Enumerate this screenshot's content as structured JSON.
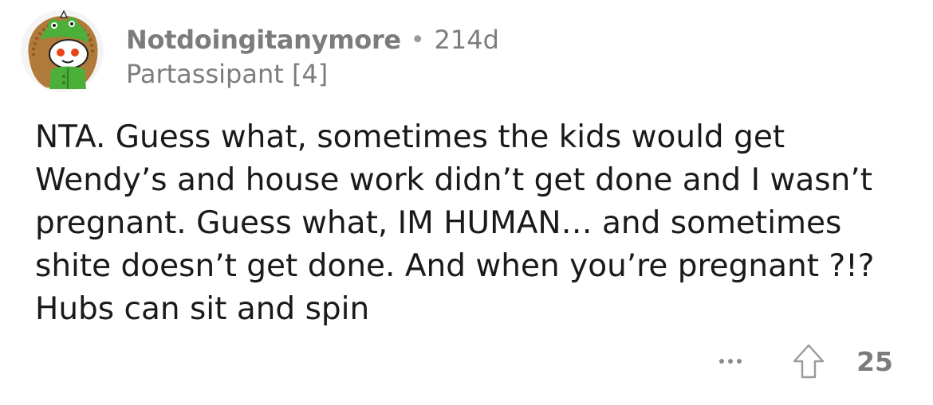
{
  "comment": {
    "author": "Notdoingitanymore",
    "separator": "•",
    "age": "214d",
    "flair": "Partassipant [4]",
    "body": "NTA. Guess what, sometimes the kids would get Wendy’s and house work didn’t get done and I wasn’t pregnant. Guess what, IM HUMAN… and sometimes shite doesn’t get done. And when you’re pregnant ?!? Hubs can sit and spin",
    "score": "25"
  },
  "icons": {
    "avatar": "snoo-avatar-frog-hood",
    "more": "more-options-icon",
    "upvote": "upvote-arrow-icon"
  },
  "colors": {
    "text": "#1a1a1b",
    "meta": "#7c7c7c",
    "icon": "#8a8a8a"
  }
}
